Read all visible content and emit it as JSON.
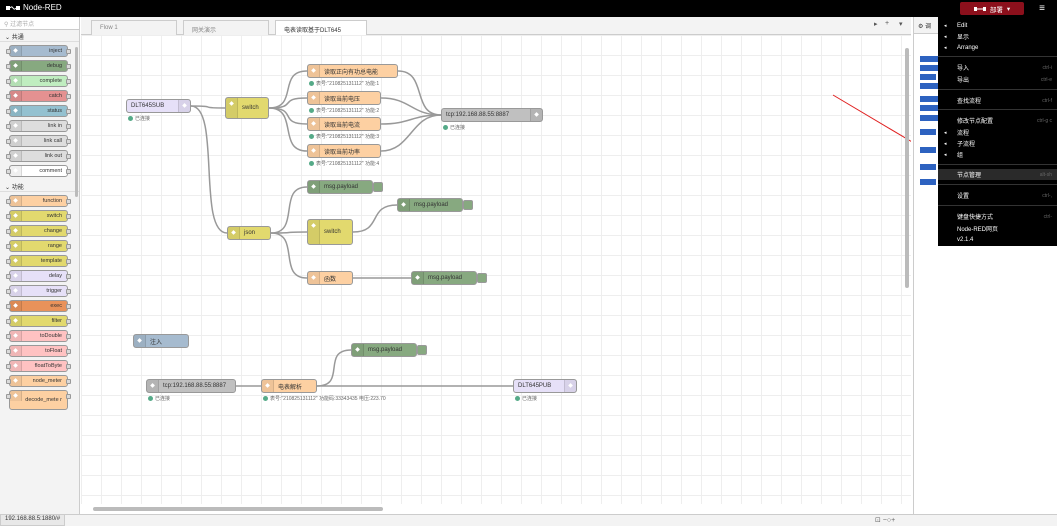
{
  "app": {
    "title": "Node-RED",
    "deploy_label": "部署",
    "menu_icon": "hamburger-icon"
  },
  "palette": {
    "filter_placeholder": "过滤节点",
    "categories": [
      {
        "label": "共通",
        "nodes": [
          {
            "label": "inject",
            "color": "#a6bbcf"
          },
          {
            "label": "debug",
            "color": "#87a980"
          },
          {
            "label": "complete",
            "color": "#c0edc0"
          },
          {
            "label": "catch",
            "color": "#e49191"
          },
          {
            "label": "status",
            "color": "#94c1d0"
          },
          {
            "label": "link in",
            "color": "#dddddd"
          },
          {
            "label": "link call",
            "color": "#dddddd"
          },
          {
            "label": "link out",
            "color": "#dddddd"
          },
          {
            "label": "comment",
            "color": "#ffffff"
          }
        ]
      },
      {
        "label": "功能",
        "nodes": [
          {
            "label": "function",
            "color": "#fdd0a2"
          },
          {
            "label": "switch",
            "color": "#e2d96e"
          },
          {
            "label": "change",
            "color": "#e2d96e"
          },
          {
            "label": "range",
            "color": "#e2d96e"
          },
          {
            "label": "template",
            "color": "#e2d96e"
          },
          {
            "label": "delay",
            "color": "#e6e0f8"
          },
          {
            "label": "trigger",
            "color": "#e6e0f8"
          },
          {
            "label": "exec",
            "color": "#e9925a"
          },
          {
            "label": "filter",
            "color": "#e2d96e"
          },
          {
            "label": "toDouble",
            "color": "#ffc2c2"
          },
          {
            "label": "toFloat",
            "color": "#ffc2c2"
          },
          {
            "label": "floatToByte",
            "color": "#ffc2c2"
          },
          {
            "label": "node_meter",
            "color": "#fdd0a2"
          },
          {
            "label": "decode_mete r",
            "color": "#fdd0a2"
          }
        ]
      }
    ]
  },
  "tabs": [
    {
      "label": "Flow 1"
    },
    {
      "label": "网关演示"
    },
    {
      "label": "电表读取基于DLT645"
    }
  ],
  "flow": {
    "nodes": {
      "dlt645sub": {
        "label": "DLT645SUB",
        "status": "已连接"
      },
      "switch1": {
        "label": "switch"
      },
      "f1": {
        "label": "读取正向有功总电能",
        "status": "表号:\"210825131112\" 功能:1"
      },
      "f2": {
        "label": "读取当前电压",
        "status": "表号:\"210825131112\" 功能:2"
      },
      "f3": {
        "label": "读取当前电流",
        "status": "表号:\"210825131112\" 功能:3"
      },
      "f4": {
        "label": "读取当前功率",
        "status": "表号:\"210825131112\" 功能:4"
      },
      "tcpout": {
        "label": "tcp:192.168.88.55:8887",
        "status": "已连接"
      },
      "json": {
        "label": "json"
      },
      "dbg1": {
        "label": "msg.payload"
      },
      "switch2": {
        "label": "switch"
      },
      "dbg2": {
        "label": "msg.payload"
      },
      "func": {
        "label": "函数"
      },
      "dbg3": {
        "label": "msg.payload"
      },
      "inject": {
        "label": "注入"
      },
      "dbg4": {
        "label": "msg.payload"
      },
      "tcpin": {
        "label": "tcp:192.168.88.55:8887",
        "status": "已连接"
      },
      "parse": {
        "label": "电表解析",
        "status": "表号:\"210825131112\" 功能码:33343435 电压:223.70"
      },
      "dlt645pub": {
        "label": "DLT645PUB",
        "status": "已连接"
      }
    }
  },
  "sidebar": {
    "tab_label": "调"
  },
  "menu": {
    "items": [
      {
        "label": "Edit",
        "key": "",
        "caret": true
      },
      {
        "label": "显示",
        "key": "",
        "caret": true
      },
      {
        "label": "Arrange",
        "key": "",
        "caret": true
      },
      {
        "label": "导入",
        "key": "ctrl-i",
        "caret": false
      },
      {
        "label": "导出",
        "key": "ctrl-e",
        "caret": false
      },
      {
        "label": "查找流程",
        "key": "ctrl-f",
        "caret": false
      },
      {
        "label": "修改节点配置",
        "key": "ctrl-g c",
        "caret": false
      },
      {
        "label": "流程",
        "key": "",
        "caret": true
      },
      {
        "label": "子流程",
        "key": "",
        "caret": true
      },
      {
        "label": "组",
        "key": "",
        "caret": true
      },
      {
        "label": "节点管理",
        "key": "alt-sh",
        "caret": false
      },
      {
        "label": "设置",
        "key": "ctrl-,",
        "caret": false
      },
      {
        "label": "键盘快捷方式",
        "key": "ctrl-",
        "caret": false
      },
      {
        "label": "Node-RED网页",
        "key": "",
        "caret": false
      },
      {
        "label": "v2.1.4",
        "key": "",
        "caret": false
      }
    ]
  },
  "status_url": "192.168.88.5:1880/#"
}
